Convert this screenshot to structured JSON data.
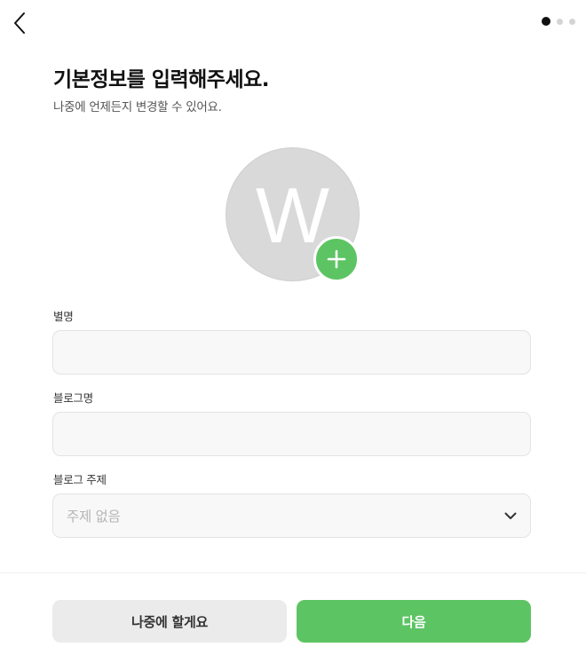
{
  "header": {
    "back_icon": "chevron-left-icon",
    "steps": {
      "total": 3,
      "current": 1
    }
  },
  "title": "기본정보를 입력해주세요.",
  "subtitle": "나중에 언제든지 변경할 수 있어요.",
  "profile": {
    "avatar_letter": "W",
    "add_icon": "plus-icon",
    "avatar_color": "#d9d9d9",
    "add_button_color": "#5dc464"
  },
  "form": {
    "nickname": {
      "label": "별명",
      "value": ""
    },
    "blog_name": {
      "label": "블로그명",
      "value": ""
    },
    "blog_topic": {
      "label": "블로그 주제",
      "value": "주제 없음",
      "icon": "chevron-down-icon"
    }
  },
  "footer": {
    "later_label": "나중에 할게요",
    "next_label": "다음"
  },
  "colors": {
    "accent": "#5dc464",
    "secondary_button": "#ebebeb"
  }
}
